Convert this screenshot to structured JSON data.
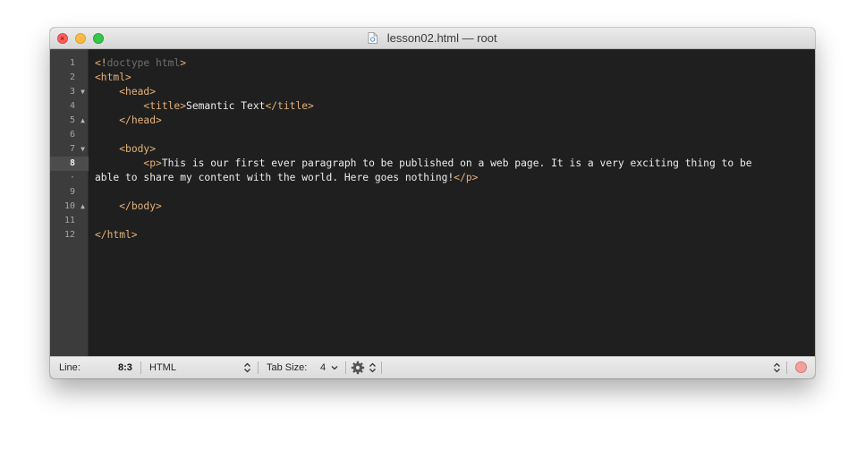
{
  "window": {
    "title": "lesson02.html — root"
  },
  "gutter": {
    "lines": [
      {
        "label": "1",
        "fold": ""
      },
      {
        "label": "2",
        "fold": ""
      },
      {
        "label": "3",
        "fold": "▼"
      },
      {
        "label": "4",
        "fold": ""
      },
      {
        "label": "5",
        "fold": "▲"
      },
      {
        "label": "6",
        "fold": ""
      },
      {
        "label": "7",
        "fold": "▼"
      },
      {
        "label": "8",
        "fold": "",
        "current": true
      },
      {
        "label": "·",
        "fold": ""
      },
      {
        "label": "9",
        "fold": ""
      },
      {
        "label": "10",
        "fold": "▲"
      },
      {
        "label": "11",
        "fold": ""
      },
      {
        "label": "12",
        "fold": ""
      }
    ]
  },
  "code": {
    "l1_open": "<!",
    "l1_doctype": "doctype html",
    "l1_close": ">",
    "l2": "<html>",
    "l3": "<head>",
    "l4_open": "<title>",
    "l4_text": "Semantic Text",
    "l4_close": "</title>",
    "l5": "</head>",
    "l7": "<body>",
    "l8_open": "<p>",
    "l8_text": "This is our first ever paragraph to be published on a web page. It is a very exciting thing to be",
    "l8b_text": "able to share my content with the world. Here goes nothing!",
    "l8b_close": "</p>",
    "l10": "</body>",
    "l12": "</html>"
  },
  "statusbar": {
    "line_label": "Line:",
    "line_value": "8:3",
    "language": "HTML",
    "tab_size_label": "Tab Size:",
    "tab_size_value": "4"
  },
  "colors": {
    "tag": "#e5b27a",
    "doctype": "#6f6f6f",
    "text": "#ececec",
    "editor_bg": "#1f1f1f",
    "gutter_bg": "#3c3c3c"
  },
  "icons": [
    "document-icon",
    "up-down-arrows-icon",
    "chevron-down-icon",
    "gear-icon",
    "record-icon"
  ]
}
